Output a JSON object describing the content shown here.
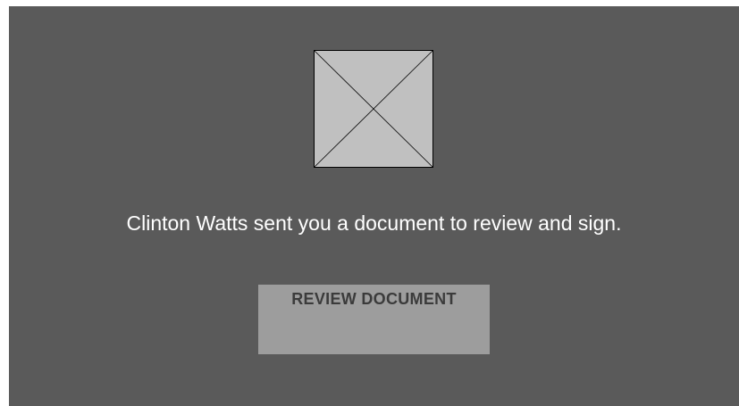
{
  "image": {
    "icon": "broken-image-placeholder-icon",
    "fill_color": "#c0c0c0",
    "stroke_color": "#000000"
  },
  "message": {
    "text": "Clinton Watts sent you a document to review and sign."
  },
  "action": {
    "label": "REVIEW DOCUMENT"
  },
  "colors": {
    "page_background": "#ffffff",
    "panel_background": "#5a5a5a",
    "message_text": "#ffffff",
    "button_background": "#9d9d9d",
    "button_text": "#3b3b3b"
  }
}
